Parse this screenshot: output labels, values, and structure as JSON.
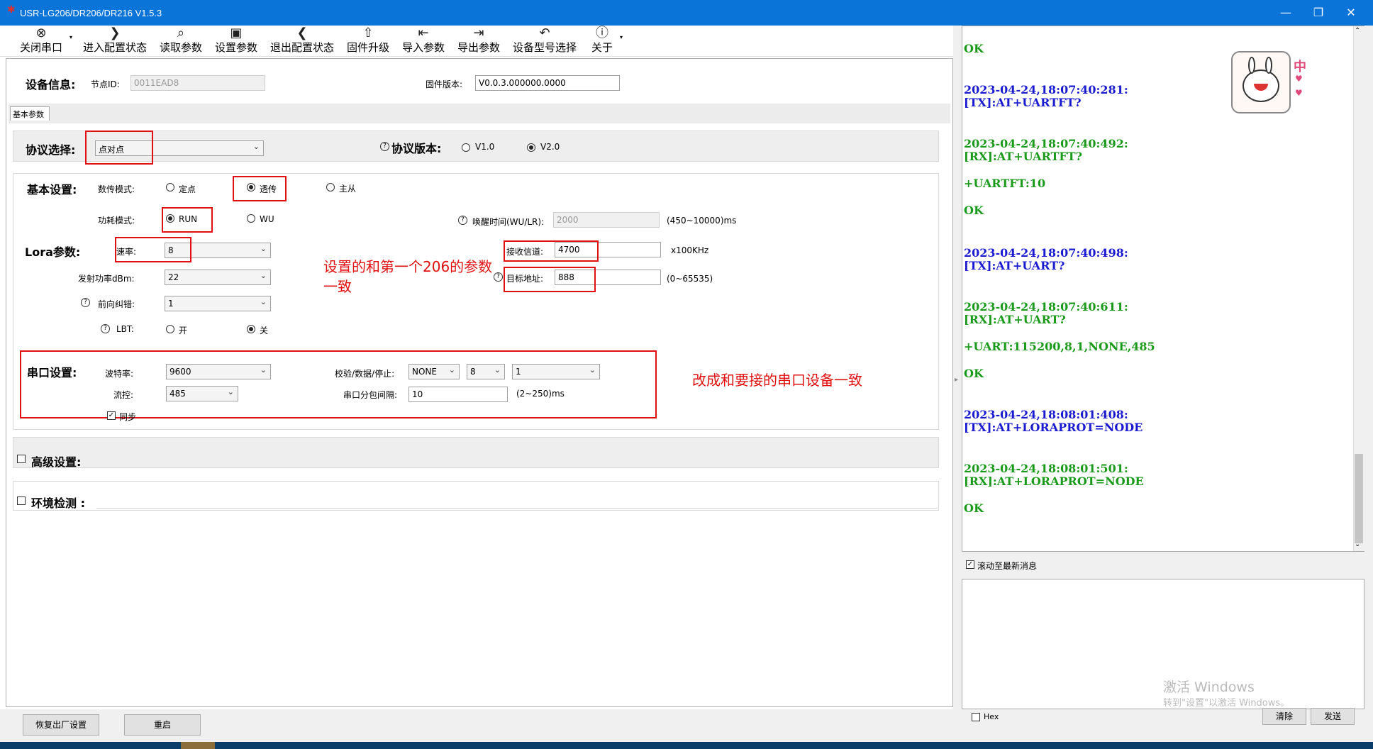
{
  "window": {
    "title": "USR-LG206/DR206/DR216 V1.5.3"
  },
  "toolbar": {
    "items": [
      {
        "label": "关闭串口",
        "icon": "⊗"
      },
      {
        "label": "进入配置状态",
        "icon": "❯"
      },
      {
        "label": "读取参数",
        "icon": "⌕"
      },
      {
        "label": "设置参数",
        "icon": "▣"
      },
      {
        "label": "退出配置状态",
        "icon": "❮"
      },
      {
        "label": "固件升级",
        "icon": "⇧"
      },
      {
        "label": "导入参数",
        "icon": "⇤"
      },
      {
        "label": "导出参数",
        "icon": "⇥"
      },
      {
        "label": "设备型号选择",
        "icon": "↶"
      },
      {
        "label": "关于",
        "icon": "ⓘ"
      }
    ]
  },
  "device": {
    "label": "设备信息:",
    "node_id_label": "节点ID:",
    "node_id": "0011EAD8",
    "fw_label": "固件版本:",
    "fw": "V0.0.3.000000.0000"
  },
  "tab": {
    "label": "基本参数"
  },
  "protocol": {
    "label": "协议选择:",
    "value": "点对点",
    "version_label": "协议版本:",
    "v1": "V1.0",
    "v2": "V2.0"
  },
  "basic": {
    "label": "基本设置:",
    "mode_label": "数传模式:",
    "opt_fixed": "定点",
    "opt_transparent": "透传",
    "opt_master": "主从",
    "power_label": "功耗模式:",
    "opt_run": "RUN",
    "opt_wu": "WU",
    "wake_label": "唤醒时间(WU/LR):",
    "wake_value": "2000",
    "wake_range": "(450~10000)ms"
  },
  "lora": {
    "label": "Lora参数:",
    "rate_label": "速率:",
    "rate": "8",
    "txpower_label": "发射功率dBm:",
    "txpower": "22",
    "fec_label": "前向纠错:",
    "fec": "1",
    "lbt_label": "LBT:",
    "lbt_on": "开",
    "lbt_off": "关",
    "channel_label": "接收信道:",
    "channel": "4700",
    "channel_unit": "x100KHz",
    "addr_label": "目标地址:",
    "addr": "888",
    "addr_range": "(0~65535)"
  },
  "serial": {
    "label": "串口设置:",
    "baud_label": "波特率:",
    "baud": "9600",
    "flow_label": "流控:",
    "flow": "485",
    "sync_label": "同步",
    "parity_label": "校验/数据/停止:",
    "parity": "NONE",
    "databits": "8",
    "stopbits": "1",
    "interval_label": "串口分包间隔:",
    "interval": "10",
    "interval_range": "(2~250)ms"
  },
  "advanced": {
    "label": "高级设置:"
  },
  "env": {
    "label": "环境检测 :"
  },
  "annotations": {
    "a1": "设置的和第一个206的参数",
    "a1b": "一致",
    "a2": "改成和要接的串口设备一致"
  },
  "buttons": {
    "restore": "恢复出厂设置",
    "reboot": "重启",
    "clear": "清除",
    "send": "发送",
    "hex": "Hex"
  },
  "log": {
    "scroll_label": "滚动至最新消息",
    "lines": [
      {
        "text": "OK",
        "color": "#1a9a1a"
      },
      {
        "text": "2023-04-24,18:07:40:281:",
        "color": "#1a1ad0"
      },
      {
        "text": "[TX]:AT+UARTFT?",
        "color": "#1a1ad0"
      },
      {
        "text": "2023-04-24,18:07:40:492:",
        "color": "#1a9a1a"
      },
      {
        "text": "[RX]:AT+UARTFT?",
        "color": "#1a9a1a"
      },
      {
        "text": "+UARTFT:10",
        "color": "#1a9a1a"
      },
      {
        "text": "OK",
        "color": "#1a9a1a"
      },
      {
        "text": "2023-04-24,18:07:40:498:",
        "color": "#1a1ad0"
      },
      {
        "text": "[TX]:AT+UART?",
        "color": "#1a1ad0"
      },
      {
        "text": "2023-04-24,18:07:40:611:",
        "color": "#1a9a1a"
      },
      {
        "text": "[RX]:AT+UART?",
        "color": "#1a9a1a"
      },
      {
        "text": "+UART:115200,8,1,NONE,485",
        "color": "#1a9a1a"
      },
      {
        "text": "OK",
        "color": "#1a9a1a"
      },
      {
        "text": "2023-04-24,18:08:01:408:",
        "color": "#1a1ad0"
      },
      {
        "text": "[TX]:AT+LORAPROT=NODE",
        "color": "#1a1ad0"
      },
      {
        "text": "2023-04-24,18:08:01:501:",
        "color": "#1a9a1a"
      },
      {
        "text": "[RX]:AT+LORAPROT=NODE",
        "color": "#1a9a1a"
      },
      {
        "text": "OK",
        "color": "#1a9a1a"
      }
    ]
  },
  "watermark": {
    "line1": "激活 Windows",
    "line2": "转到\"设置\"以激活 Windows。"
  },
  "sticker": {
    "text": "中"
  }
}
